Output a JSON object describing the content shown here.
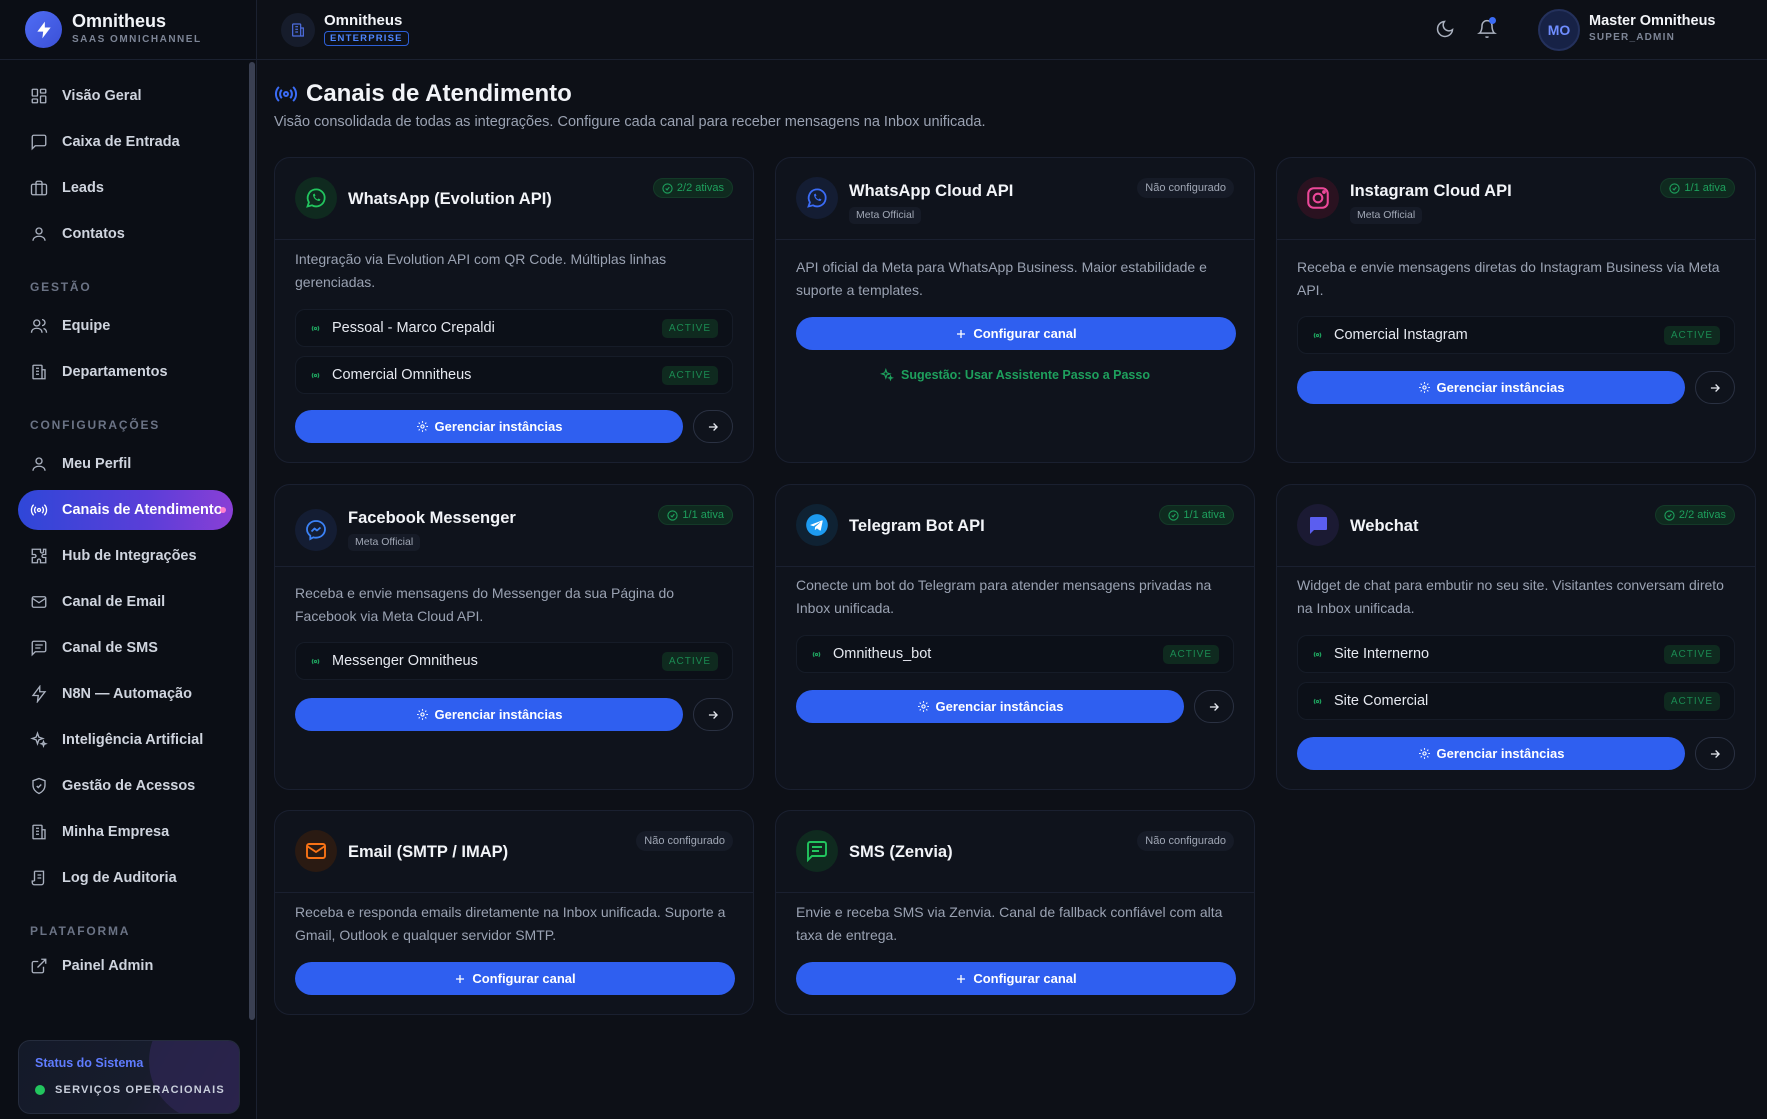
{
  "brand": {
    "name": "Omnitheus",
    "subtitle": "SAAS OMNICHANNEL"
  },
  "header": {
    "org_name": "Omnitheus",
    "org_badge": "ENTERPRISE",
    "user_initials": "MO",
    "user_name": "Master Omnitheus",
    "user_role": "SUPER_ADMIN"
  },
  "sidebar": {
    "main": [
      {
        "label": "Visão Geral",
        "icon": "grid-icon"
      },
      {
        "label": "Caixa de Entrada",
        "icon": "message-square-icon"
      },
      {
        "label": "Leads",
        "icon": "briefcase-icon"
      },
      {
        "label": "Contatos",
        "icon": "user-icon"
      }
    ],
    "section_gestao": "GESTÃO",
    "gestao": [
      {
        "label": "Equipe",
        "icon": "users-icon"
      },
      {
        "label": "Departamentos",
        "icon": "building-icon"
      }
    ],
    "section_config": "CONFIGURAÇÕES",
    "config": [
      {
        "label": "Meu Perfil",
        "icon": "user-icon"
      },
      {
        "label": "Canais de Atendimento",
        "icon": "radio-icon",
        "active": true
      },
      {
        "label": "Hub de Integrações",
        "icon": "puzzle-icon"
      },
      {
        "label": "Canal de Email",
        "icon": "mail-icon"
      },
      {
        "label": "Canal de SMS",
        "icon": "message-text-icon"
      },
      {
        "label": "N8N — Automação",
        "icon": "zap-icon"
      },
      {
        "label": "Inteligência Artificial",
        "icon": "sparkles-icon"
      },
      {
        "label": "Gestão de Acessos",
        "icon": "shield-icon"
      },
      {
        "label": "Minha Empresa",
        "icon": "building-icon"
      },
      {
        "label": "Log de Auditoria",
        "icon": "scroll-icon"
      }
    ],
    "section_plataforma": "PLATAFORMA",
    "plataforma": [
      {
        "label": "Painel Admin",
        "icon": "external-link-icon"
      }
    ],
    "status": {
      "title": "Status do Sistema",
      "text": "SERVIÇOS OPERACIONAIS"
    }
  },
  "page": {
    "title": "Canais de Atendimento",
    "subtitle": "Visão consolidada de todas as integrações. Configure cada canal para receber mensagens na Inbox unificada."
  },
  "cards": {
    "whatsapp_evo": {
      "name": "WhatsApp (Evolution API)",
      "status": "2/2 ativas",
      "desc": "Integração via Evolution API com QR Code. Múltiplas linhas gerenciadas.",
      "instances": [
        {
          "name": "Pessoal - Marco Crepaldi",
          "status": "ACTIVE"
        },
        {
          "name": "Comercial Omnitheus",
          "status": "ACTIVE"
        }
      ],
      "button": "Gerenciar instâncias"
    },
    "whatsapp_cloud": {
      "name": "WhatsApp Cloud API",
      "tag": "Meta Official",
      "status": "Não configurado",
      "desc": "API oficial da Meta para WhatsApp Business. Maior estabilidade e suporte a templates.",
      "button": "Configurar canal",
      "suggestion": "Sugestão: Usar Assistente Passo a Passo"
    },
    "instagram": {
      "name": "Instagram Cloud API",
      "tag": "Meta Official",
      "status": "1/1 ativa",
      "desc": "Receba e envie mensagens diretas do Instagram Business via Meta API.",
      "instances": [
        {
          "name": "Comercial Instagram",
          "status": "ACTIVE"
        }
      ],
      "button": "Gerenciar instâncias"
    },
    "messenger": {
      "name": "Facebook Messenger",
      "tag": "Meta Official",
      "status": "1/1 ativa",
      "desc": "Receba e envie mensagens do Messenger da sua Página do Facebook via Meta Cloud API.",
      "instances": [
        {
          "name": "Messenger Omnitheus",
          "status": "ACTIVE"
        }
      ],
      "button": "Gerenciar instâncias"
    },
    "telegram": {
      "name": "Telegram Bot API",
      "status": "1/1 ativa",
      "desc": "Conecte um bot do Telegram para atender mensagens privadas na Inbox unificada.",
      "instances": [
        {
          "name": "Omnitheus_bot",
          "status": "ACTIVE"
        }
      ],
      "button": "Gerenciar instâncias"
    },
    "webchat": {
      "name": "Webchat",
      "status": "2/2 ativas",
      "desc": "Widget de chat para embutir no seu site. Visitantes conversam direto na Inbox unificada.",
      "instances": [
        {
          "name": "Site Internerno",
          "status": "ACTIVE"
        },
        {
          "name": "Site Comercial",
          "status": "ACTIVE"
        }
      ],
      "button": "Gerenciar instâncias"
    },
    "email": {
      "name": "Email (SMTP / IMAP)",
      "status": "Não configurado",
      "desc": "Receba e responda emails diretamente na Inbox unificada. Suporte a Gmail, Outlook e qualquer servidor SMTP.",
      "button": "Configurar canal"
    },
    "sms": {
      "name": "SMS (Zenvia)",
      "status": "Não configurado",
      "desc": "Envie e receba SMS via Zenvia. Canal de fallback confiável com alta taxa de entrega.",
      "button": "Configurar canal"
    }
  },
  "colors": {
    "accent": "#2f5ff0",
    "success": "#1ea05d",
    "background": "#0d1017"
  }
}
